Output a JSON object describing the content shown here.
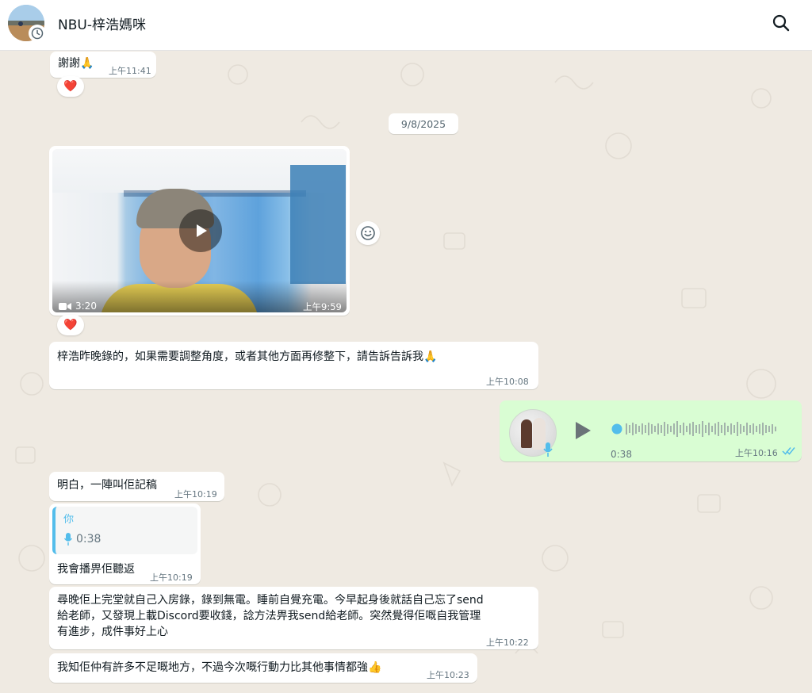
{
  "header": {
    "title": "NBU-梓浩媽咪"
  },
  "messages": {
    "m1": {
      "text": "謝謝",
      "emoji": "🙏",
      "time": "上午11:41",
      "reaction": "❤️"
    },
    "date_separator": "9/8/2025",
    "video": {
      "duration": "3:20",
      "time": "上午9:59",
      "reaction": "❤️"
    },
    "m2": {
      "text": "梓浩昨晚錄的，如果需要調整角度，或者其他方面再修整下，請告訴告訴我",
      "emoji": "🙏",
      "time": "上午10:08"
    },
    "voice": {
      "duration": "0:38",
      "time": "上午10:16",
      "status": "read"
    },
    "m3": {
      "text": "明白，一陣叫佢記稿",
      "time": "上午10:19"
    },
    "m4": {
      "quote_author": "你",
      "quote_duration": "0:38",
      "text": "我會播畀佢聽返",
      "time": "上午10:19"
    },
    "m5": {
      "line1": "尋晚佢上完堂就自己入房錄，錄到無電。睡前自覺充電。今早起身後就話自己忘了send",
      "line2": "給老師，又發現上載Discord要收錢，諗方法畀我send給老師。突然覺得佢嘅自我管理",
      "line3": "有進步，成件事好上心",
      "time": "上午10:22"
    },
    "m6": {
      "text": "我知佢仲有許多不足嘅地方，不過今次嘅行動力比其他事情都強",
      "emoji": "👍",
      "time": "上午10:23"
    }
  },
  "colors": {
    "chat_bg": "#efeae2",
    "incoming": "#ffffff",
    "outgoing": "#d9fdd3",
    "read_ticks": "#53bdeb",
    "voice_accent": "#53bdeb"
  }
}
